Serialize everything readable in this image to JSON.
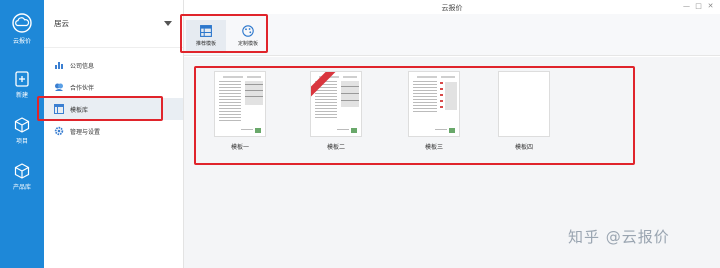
{
  "window": {
    "title": "云报价",
    "controls": [
      "—",
      "□",
      "✕"
    ]
  },
  "rail": {
    "items": [
      {
        "label": "云报价",
        "icon": "cloud-logo-icon"
      },
      {
        "label": "新建",
        "icon": "new-doc-icon"
      },
      {
        "label": "项目",
        "icon": "project-cube-icon"
      },
      {
        "label": "产品库",
        "icon": "product-cube-icon"
      }
    ]
  },
  "sidebar": {
    "company": "居云",
    "items": [
      {
        "label": "公司信息",
        "icon": "company-icon",
        "active": false
      },
      {
        "label": "合作伙伴",
        "icon": "partner-icon",
        "active": false
      },
      {
        "label": "模板库",
        "icon": "template-icon",
        "active": true
      },
      {
        "label": "管理与设置",
        "icon": "settings-gear-icon",
        "active": false
      }
    ]
  },
  "toolbar": {
    "buttons": [
      {
        "label": "推荐模板",
        "icon": "recommend-template-icon",
        "active": true
      },
      {
        "label": "定制模板",
        "icon": "custom-template-icon",
        "active": false
      }
    ]
  },
  "templates": [
    {
      "name": "模板一",
      "ribbon": false,
      "blank": false
    },
    {
      "name": "模板二",
      "ribbon": true,
      "blank": false
    },
    {
      "name": "模板三",
      "ribbon": false,
      "blank": false
    },
    {
      "name": "模板四",
      "ribbon": false,
      "blank": true
    }
  ],
  "watermark": "知乎 @云报价",
  "colors": {
    "rail": "#1e88d8",
    "highlight": "#e0242b",
    "ribbon": "#d9363e"
  }
}
